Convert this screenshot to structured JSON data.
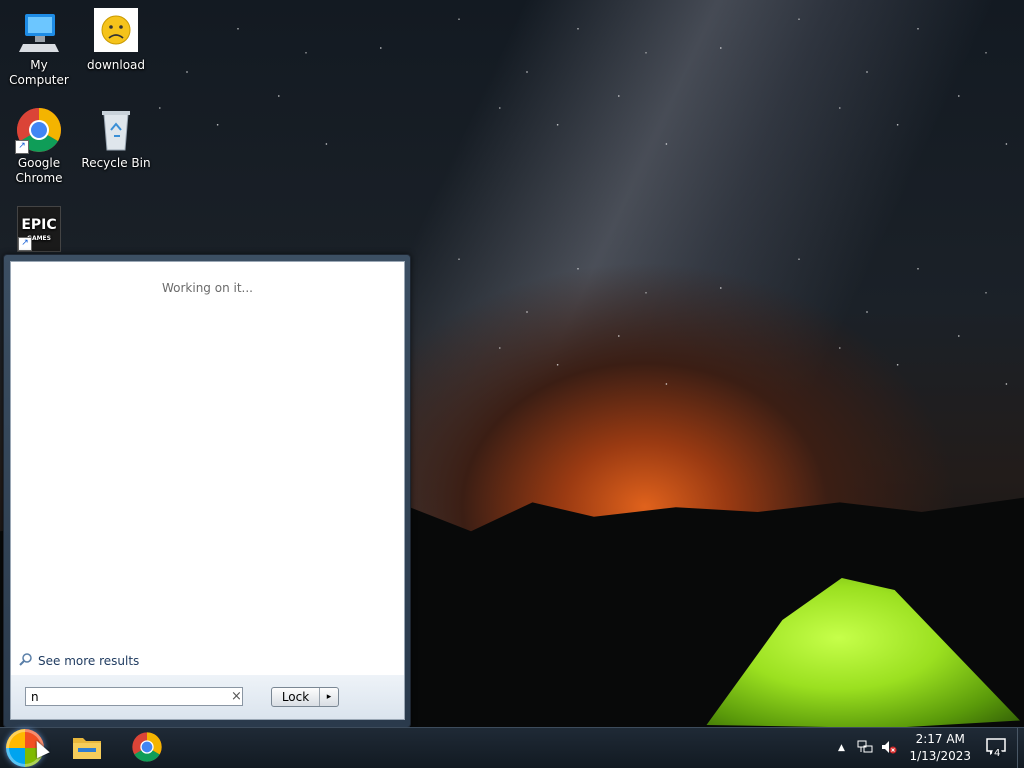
{
  "desktop": {
    "icons": [
      {
        "label": "My Computer",
        "icon": "computer-icon"
      },
      {
        "label": "download",
        "icon": "sad-face-icon"
      },
      {
        "label": "Google Chrome",
        "icon": "chrome-icon"
      },
      {
        "label": "Recycle Bin",
        "icon": "recycle-bin-icon"
      },
      {
        "label": "EPIC GAMES",
        "icon": "epic-games-icon"
      }
    ]
  },
  "start_menu": {
    "status_text": "Working on it...",
    "see_more": "See more results",
    "search": {
      "value": "n",
      "clear_icon": "close-icon"
    },
    "lock_button": "Lock",
    "lock_arrow": "▸"
  },
  "taskbar": {
    "pinned": [
      {
        "name": "file-explorer",
        "icon": "folder-icon"
      },
      {
        "name": "google-chrome",
        "icon": "chrome-icon"
      }
    ],
    "tray": {
      "show_hidden": "▲",
      "time": "2:17 AM",
      "date": "1/13/2023",
      "notification_count": "4"
    }
  }
}
